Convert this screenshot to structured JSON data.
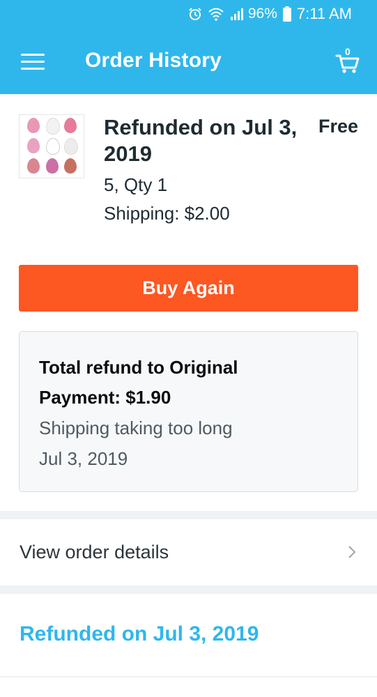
{
  "status_bar": {
    "battery": "96%",
    "time": "7:11 AM",
    "icons": [
      "alarm-icon",
      "wifi-icon",
      "signal-icon",
      "battery-icon"
    ]
  },
  "app_bar": {
    "title": "Order History",
    "cart_count": "0",
    "color": "#2fb7ec"
  },
  "order": {
    "title": "Refunded on Jul 3, 2019",
    "price": "Free",
    "qty": "5, Qty 1",
    "shipping": "Shipping: $2.00",
    "buy_again_label": "Buy Again",
    "buy_again_color": "#fd5722",
    "refund": {
      "total": "Total refund to Original Payment: $1.90",
      "reason": "Shipping taking too long",
      "date": "Jul 3, 2019"
    },
    "view_details_label": "View order details"
  },
  "next_order": {
    "header": "Refunded on Jul 3, 2019"
  }
}
